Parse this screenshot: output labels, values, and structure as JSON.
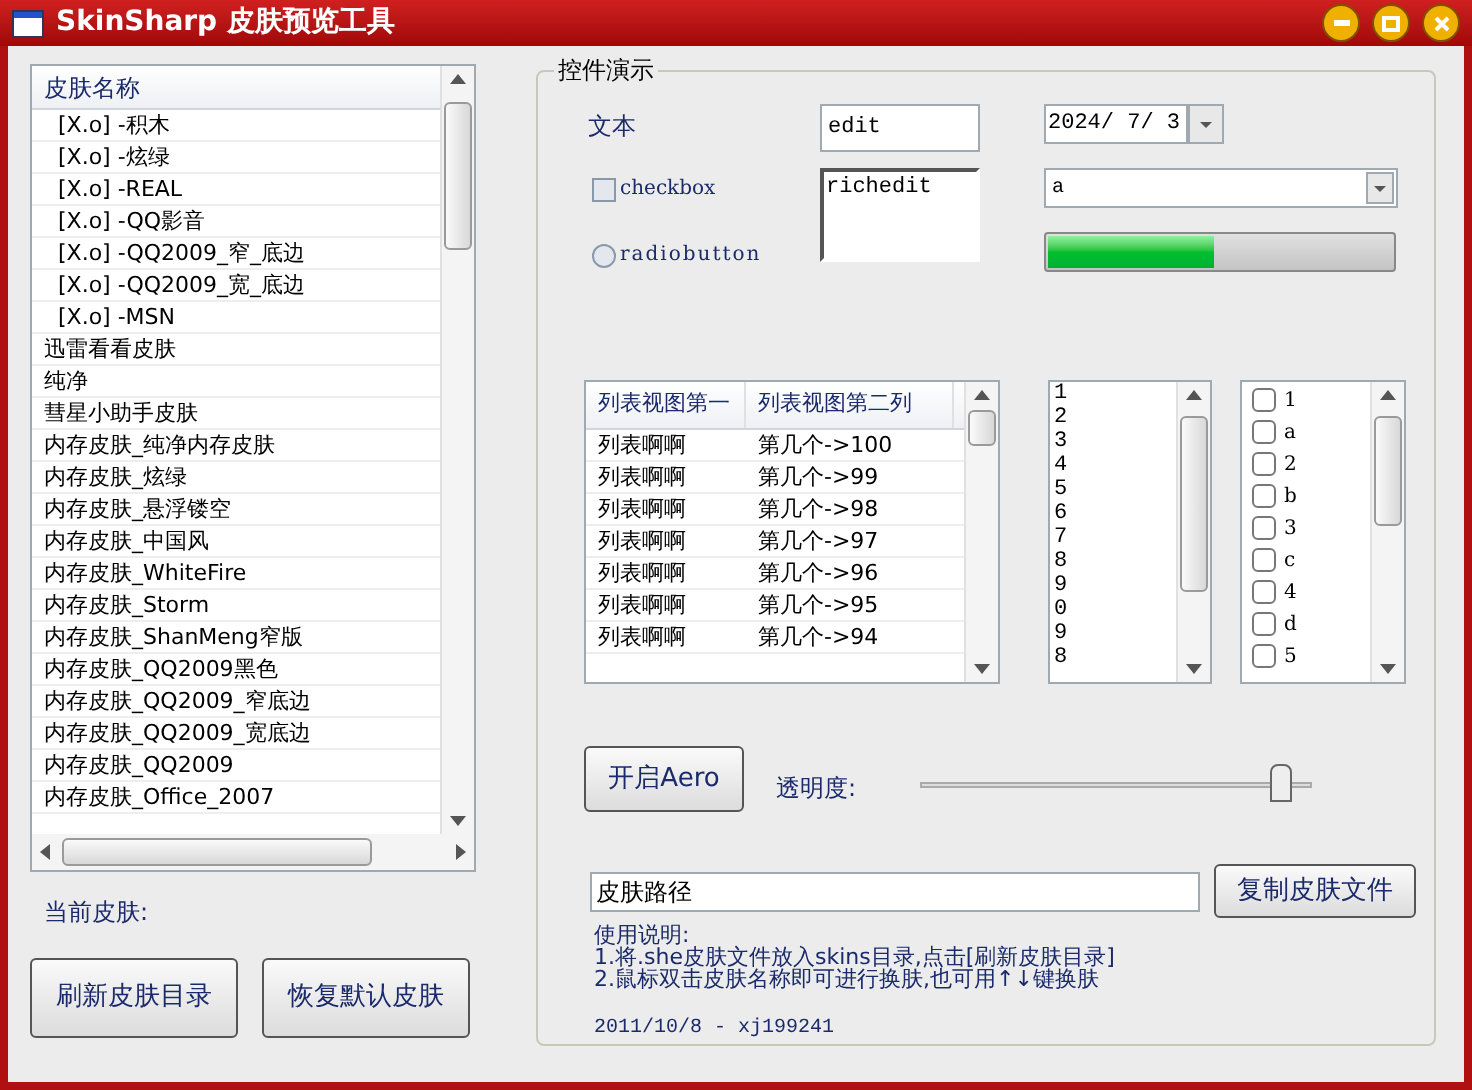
{
  "window": {
    "title": "SkinSharp 皮肤预览工具"
  },
  "skin_list": {
    "header": "皮肤名称",
    "items": [
      {
        "label": "[X.o] -积木",
        "indented": true
      },
      {
        "label": "[X.o] -炫绿",
        "indented": true
      },
      {
        "label": "[X.o] -REAL",
        "indented": true
      },
      {
        "label": "[X.o] -QQ影音",
        "indented": true
      },
      {
        "label": "[X.o] -QQ2009_窄_底边",
        "indented": true
      },
      {
        "label": "[X.o] -QQ2009_宽_底边",
        "indented": true
      },
      {
        "label": "[X.o] -MSN",
        "indented": true
      },
      {
        "label": "迅雷看看皮肤",
        "indented": false
      },
      {
        "label": "纯净",
        "indented": false
      },
      {
        "label": "彗星小助手皮肤",
        "indented": false
      },
      {
        "label": "内存皮肤_纯净内存皮肤",
        "indented": false
      },
      {
        "label": "内存皮肤_炫绿",
        "indented": false
      },
      {
        "label": "内存皮肤_悬浮镂空",
        "indented": false
      },
      {
        "label": "内存皮肤_中国风",
        "indented": false
      },
      {
        "label": "内存皮肤_WhiteFire",
        "indented": false
      },
      {
        "label": "内存皮肤_Storm",
        "indented": false
      },
      {
        "label": "内存皮肤_ShanMeng窄版",
        "indented": false
      },
      {
        "label": "内存皮肤_QQ2009黑色",
        "indented": false
      },
      {
        "label": "内存皮肤_QQ2009_窄底边",
        "indented": false
      },
      {
        "label": "内存皮肤_QQ2009_宽底边",
        "indented": false
      },
      {
        "label": "内存皮肤_QQ2009",
        "indented": false
      },
      {
        "label": "内存皮肤_Office_2007",
        "indented": false
      }
    ]
  },
  "current_skin_label": "当前皮肤:",
  "left_buttons": [
    "刷新皮肤目录",
    "恢复默认皮肤"
  ],
  "demo": {
    "title": "控件演示",
    "text_label": "文本",
    "edit": {
      "value": "edit"
    },
    "date": {
      "value": "2024/ 7/ 3"
    },
    "checkbox": {
      "label": "checkbox",
      "checked": false
    },
    "radio": {
      "label": "radiobutton",
      "selected": false
    },
    "richedit": {
      "value": "richedit"
    },
    "combo": {
      "value": "a"
    },
    "progress": {
      "level": 0.48
    },
    "list_view": {
      "columns": [
        "列表视图第一",
        "列表视图第二列"
      ],
      "rows": [
        [
          "列表啊啊",
          "第几个->100"
        ],
        [
          "列表啊啊",
          "第几个->99"
        ],
        [
          "列表啊啊",
          "第几个->98"
        ],
        [
          "列表啊啊",
          "第几个->97"
        ],
        [
          "列表啊啊",
          "第几个->96"
        ],
        [
          "列表啊啊",
          "第几个->95"
        ],
        [
          "列表啊啊",
          "第几个->94"
        ]
      ]
    },
    "list_box": [
      "1",
      "2",
      "3",
      "4",
      "5",
      "6",
      "7",
      "8",
      "9",
      "0",
      "9",
      "8"
    ],
    "check_list": [
      {
        "label": "1",
        "checked": false
      },
      {
        "label": "a",
        "checked": false
      },
      {
        "label": "2",
        "checked": false
      },
      {
        "label": "b",
        "checked": false
      },
      {
        "label": "3",
        "checked": false
      },
      {
        "label": "c",
        "checked": false
      },
      {
        "label": "4",
        "checked": false
      },
      {
        "label": "d",
        "checked": false
      },
      {
        "label": "5",
        "checked": false
      }
    ],
    "aero_button": "开启Aero",
    "opacity_label": "透明度:",
    "opacity": {
      "level": 0.95
    },
    "path_field": {
      "value": "皮肤路径"
    },
    "copy_button": "复制皮肤文件",
    "instructions": [
      "使用说明:",
      "1.将.she皮肤文件放入skins目录,点击[刷新皮肤目录]",
      "2.鼠标双击皮肤名称即可进行换肤,也可用↑↓键换肤"
    ],
    "footer": "2011/10/8 - xj199241"
  }
}
